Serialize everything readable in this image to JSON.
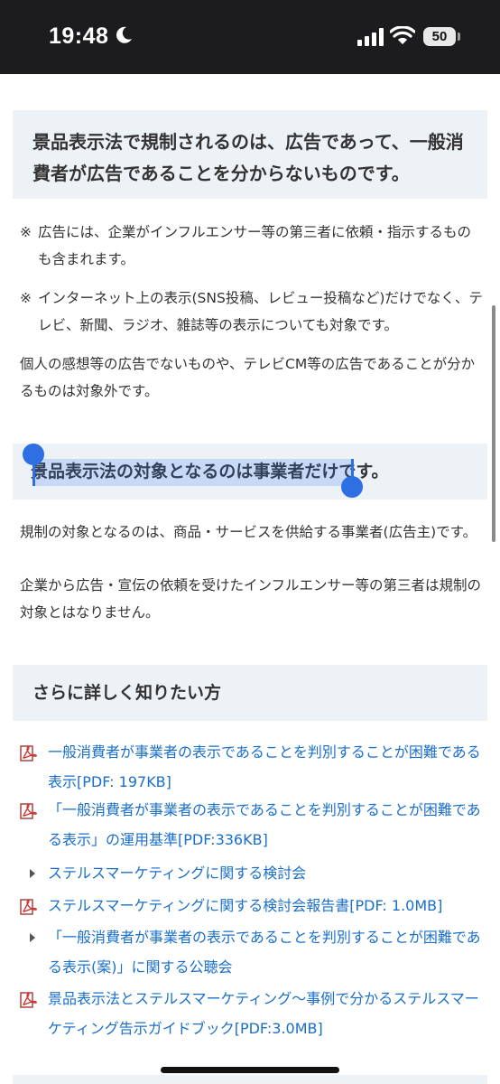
{
  "status_bar": {
    "time": "19:48",
    "battery": "50",
    "icons": [
      "moon-icon",
      "signal-icon",
      "wifi-icon",
      "battery-icon"
    ]
  },
  "section1": {
    "heading": "景品表示法で規制されるのは、広告であって、一般消費者が広告であることを分からないものです。",
    "notes": [
      {
        "mark": "※",
        "text": "広告には、企業がインフルエンサー等の第三者に依頼・指示するものも含まれます。"
      },
      {
        "mark": "※",
        "text": "インターネット上の表示(SNS投稿、レビュー投稿など)だけでなく、テレビ、新聞、ラジオ、雑誌等の表示についても対象です。"
      }
    ],
    "paragraph": "個人の感想等の広告でないものや、テレビCM等の広告であることが分かるものは対象外です。"
  },
  "section2": {
    "heading": "景品表示法の対象となるのは事業者だけです。",
    "paragraph1": "規制の対象となるのは、商品・サービスを供給する事業者(広告主)です。",
    "paragraph2": "企業から広告・宣伝の依頼を受けたインフルエンサー等の第三者は規制の対象とはなりません。"
  },
  "section3": {
    "heading": "さらに詳しく知りたい方",
    "links": [
      {
        "icon": "pdf-icon",
        "text": "一般消費者が事業者の表示であることを判別することが困難である表示[PDF: 197KB]"
      },
      {
        "icon": "pdf-icon",
        "text": "「一般消費者が事業者の表示であることを判別することが困難である表示」の運用基準[PDF:336KB]"
      },
      {
        "icon": "arrow-icon",
        "text": "ステルスマーケティングに関する検討会"
      },
      {
        "icon": "pdf-icon",
        "text": "ステルスマーケティングに関する検討会報告書[PDF: 1.0MB]"
      },
      {
        "icon": "arrow-icon",
        "text": "「一般消費者が事業者の表示であることを判別することが困難である表示(案)」に関する公聴会"
      },
      {
        "icon": "pdf-icon",
        "text": "景品表示法とステルスマーケティング～事例で分かるステルスマーケティング告示ガイドブック[PDF:3.0MB]"
      }
    ]
  },
  "colors": {
    "link": "#1a6fc9",
    "heading_bg": "#edf2f7",
    "selection_handle": "#2f6fe4",
    "status_bar_bg": "#1c1c1e"
  }
}
